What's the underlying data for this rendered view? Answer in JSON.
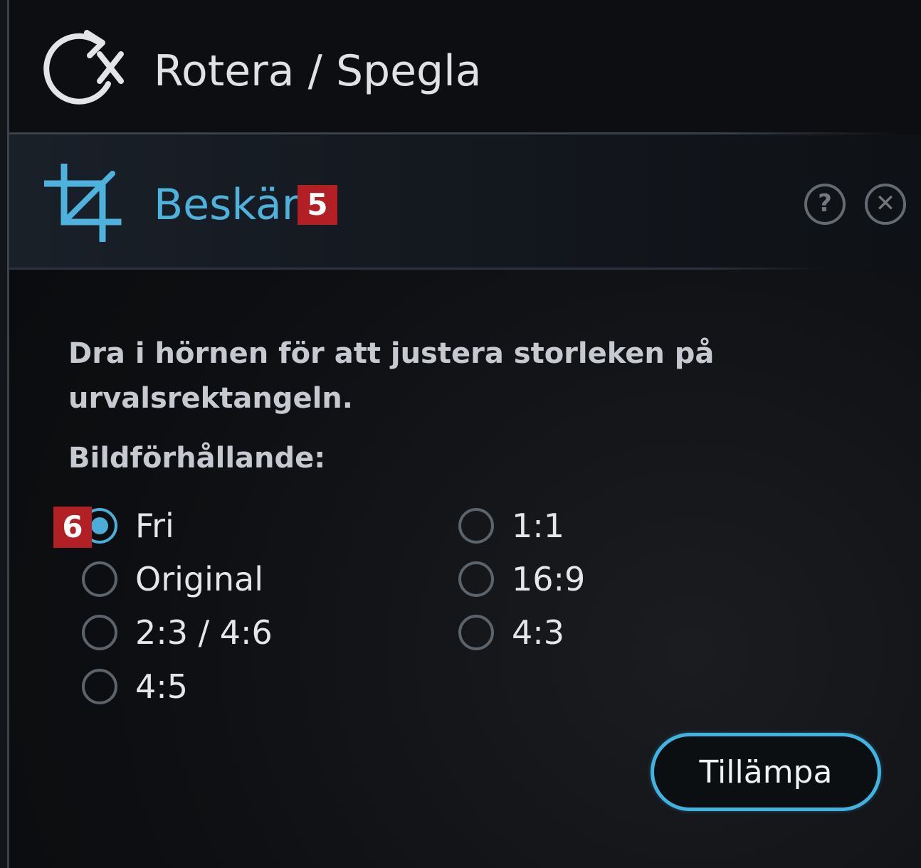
{
  "rotate_section": {
    "label": "Rotera / Spegla",
    "icon": "rotate-icon"
  },
  "crop_section": {
    "label": "Beskär",
    "badge": "5",
    "icon": "crop-icon",
    "help_icon": "?",
    "close_icon": "✕"
  },
  "crop_panel": {
    "description": "Dra i hörnen för att justera storleken på urvalsrektangeln.",
    "ratio_label": "Bildförhållande:",
    "options_badge": "6",
    "options": [
      {
        "label": "Fri",
        "checked": true
      },
      {
        "label": "Original",
        "checked": false
      },
      {
        "label": "2:3 / 4:6",
        "checked": false
      },
      {
        "label": "4:5",
        "checked": false
      },
      {
        "label": "1:1",
        "checked": false
      },
      {
        "label": "16:9",
        "checked": false
      },
      {
        "label": "4:3",
        "checked": false
      }
    ],
    "apply_label": "Tillämpa"
  },
  "colors": {
    "accent": "#4fb2dc",
    "badge": "#b21f24",
    "background": "#0b0d10"
  }
}
